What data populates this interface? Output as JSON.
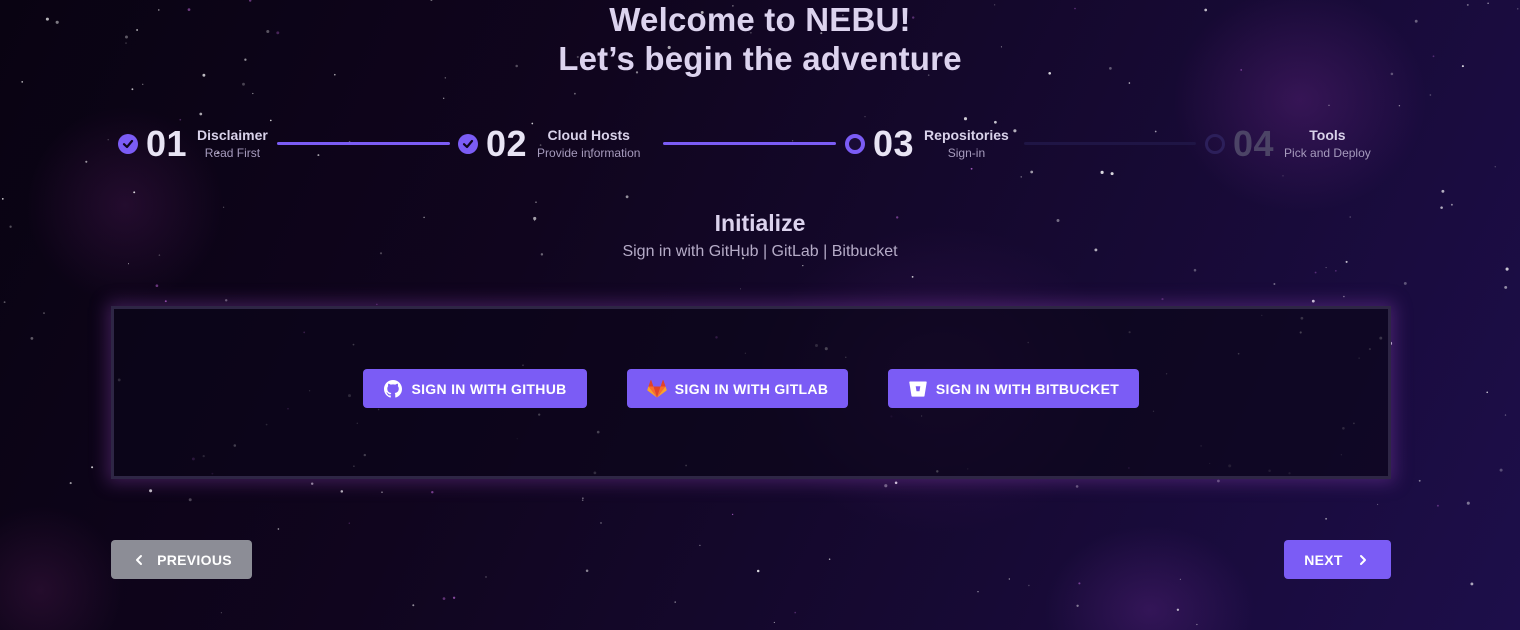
{
  "page": {
    "title_line1": "Welcome to NEBU!",
    "title_line2": "Let’s begin the adventure"
  },
  "stepper": {
    "steps": [
      {
        "number": "01",
        "label": "Disclaimer",
        "sublabel": "Read First",
        "state": "done"
      },
      {
        "number": "02",
        "label": "Cloud Hosts",
        "sublabel": "Provide information",
        "state": "done"
      },
      {
        "number": "03",
        "label": "Repositories",
        "sublabel": "Sign-in",
        "state": "current"
      },
      {
        "number": "04",
        "label": "Tools",
        "sublabel": "Pick and Deploy",
        "state": "todo"
      }
    ]
  },
  "section": {
    "title": "Initialize",
    "subtitle": "Sign in with GitHub | GitLab | Bitbucket"
  },
  "signin": {
    "github_label": "SIGN IN WITH GITHUB",
    "gitlab_label": "SIGN IN WITH GITLAB",
    "bitbucket_label": "SIGN IN WITH BITBUCKET",
    "github_icon": "github-icon",
    "gitlab_icon": "gitlab-icon",
    "bitbucket_icon": "bitbucket-icon"
  },
  "nav": {
    "previous_label": "PREVIOUS",
    "next_label": "NEXT"
  },
  "colors": {
    "accent": "#7b5cf5",
    "previous_button": "#8c8d96",
    "background": "#10051e"
  }
}
